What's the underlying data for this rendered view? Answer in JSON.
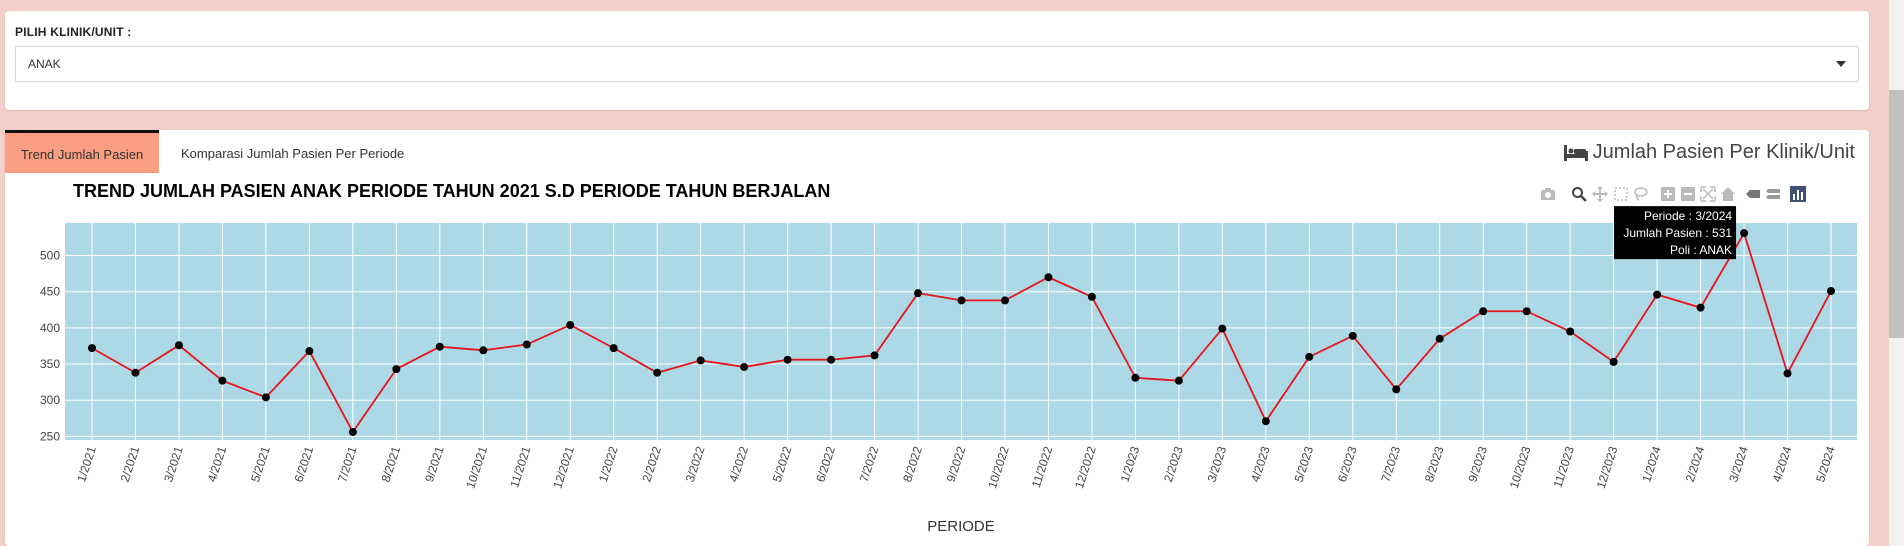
{
  "filter": {
    "label": "PILIH KLINIK/UNIT :",
    "selected": "ANAK"
  },
  "tabs": [
    {
      "label": "Trend Jumlah Pasien",
      "active": true
    },
    {
      "label": "Komparasi Jumlah Pasien Per Periode",
      "active": false
    }
  ],
  "panel_title": "Jumlah Pasien Per Klinik/Unit",
  "colors": {
    "page_bg": "#f5d0cb",
    "plot_bg": "#add8e6",
    "line": "#e8141b",
    "marker": "#000000",
    "active_tab": "#fa9e81"
  },
  "modebar_icons": [
    "camera-icon",
    "zoom-icon",
    "pan-icon",
    "box-select-icon",
    "lasso-icon",
    "zoom-in-icon",
    "zoom-out-icon",
    "autoscale-icon",
    "home-icon",
    "hover-closest-icon",
    "hover-compare-icon",
    "plotly-logo-icon"
  ],
  "tooltip": {
    "line1": "Periode : 3/2024",
    "line2": "Jumlah Pasien : 531",
    "line3": "Poli : ANAK"
  },
  "chart_data": {
    "type": "line",
    "title": "TREND JUMLAH PASIEN ANAK PERIODE TAHUN 2021 S.D PERIODE TAHUN BERJALAN",
    "xlabel": "PERIODE",
    "ylabel": "",
    "ylim": [
      245,
      545
    ],
    "yticks": [
      250,
      300,
      350,
      400,
      450,
      500
    ],
    "grid": true,
    "categories": [
      "1/2021",
      "2/2021",
      "3/2021",
      "4/2021",
      "5/2021",
      "6/2021",
      "7/2021",
      "8/2021",
      "9/2021",
      "10/2021",
      "11/2021",
      "12/2021",
      "1/2022",
      "2/2022",
      "3/2022",
      "4/2022",
      "5/2022",
      "6/2022",
      "7/2022",
      "8/2022",
      "9/2022",
      "10/2022",
      "11/2022",
      "12/2022",
      "1/2023",
      "2/2023",
      "3/2023",
      "4/2023",
      "5/2023",
      "6/2023",
      "7/2023",
      "8/2023",
      "9/2023",
      "10/2023",
      "11/2023",
      "12/2023",
      "1/2024",
      "2/2024",
      "3/2024",
      "4/2024",
      "5/2024"
    ],
    "series": [
      {
        "values": [
          372,
          338,
          376,
          327,
          304,
          368,
          256,
          343,
          374,
          369,
          377,
          404,
          372,
          338,
          355,
          346,
          356,
          356,
          362,
          448,
          438,
          438,
          470,
          443,
          331,
          327,
          399,
          271,
          360,
          389,
          315,
          385,
          423,
          423,
          395,
          353,
          446,
          428,
          531,
          337,
          451
        ]
      }
    ]
  }
}
